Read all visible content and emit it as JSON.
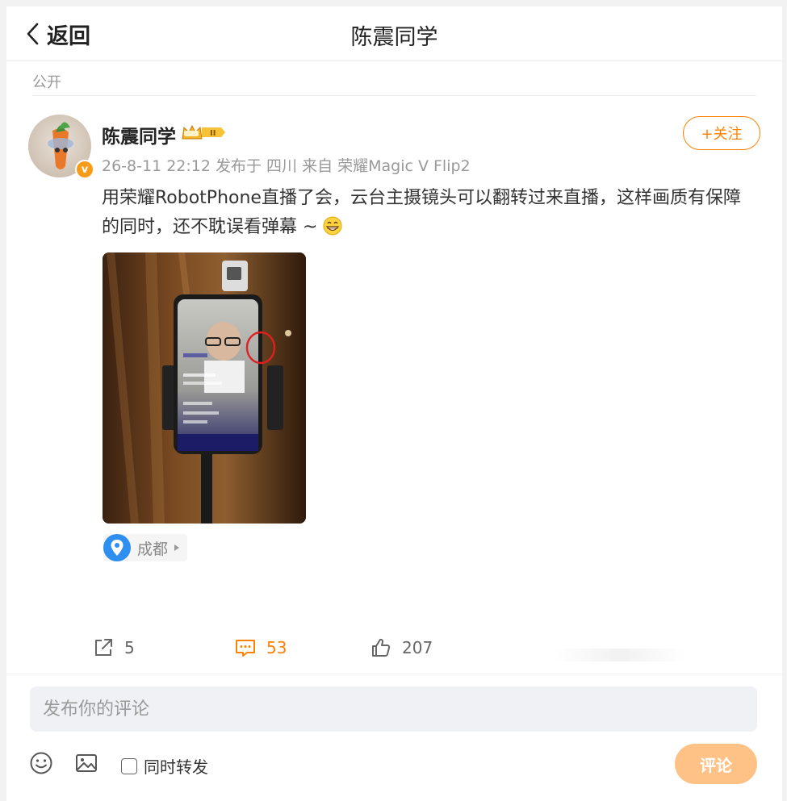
{
  "header": {
    "back_label": "返回",
    "title": "陈震同学"
  },
  "visibility": "公开",
  "author": {
    "name": "陈震同学",
    "vip_level": "II",
    "follow_label": "+关注"
  },
  "meta": {
    "text": "26-8-11 22:12 发布于 四川 来自 荣耀Magic V Flip2"
  },
  "post": {
    "text": "用荣耀RobotPhone直播了会，云台主摄镜头可以翻转过来直播，这样画质有保障的同时，还不耽误看弹幕 ~"
  },
  "location": {
    "label": "成都"
  },
  "actions": {
    "repost_count": "5",
    "comment_count": "53",
    "like_count": "207"
  },
  "composer": {
    "placeholder": "发布你的评论",
    "repost_label": "同时转发",
    "submit_label": "评论"
  },
  "colors": {
    "accent": "#ff8200",
    "submit_bg": "#ffc286",
    "location_pin": "#2e8ff0"
  }
}
